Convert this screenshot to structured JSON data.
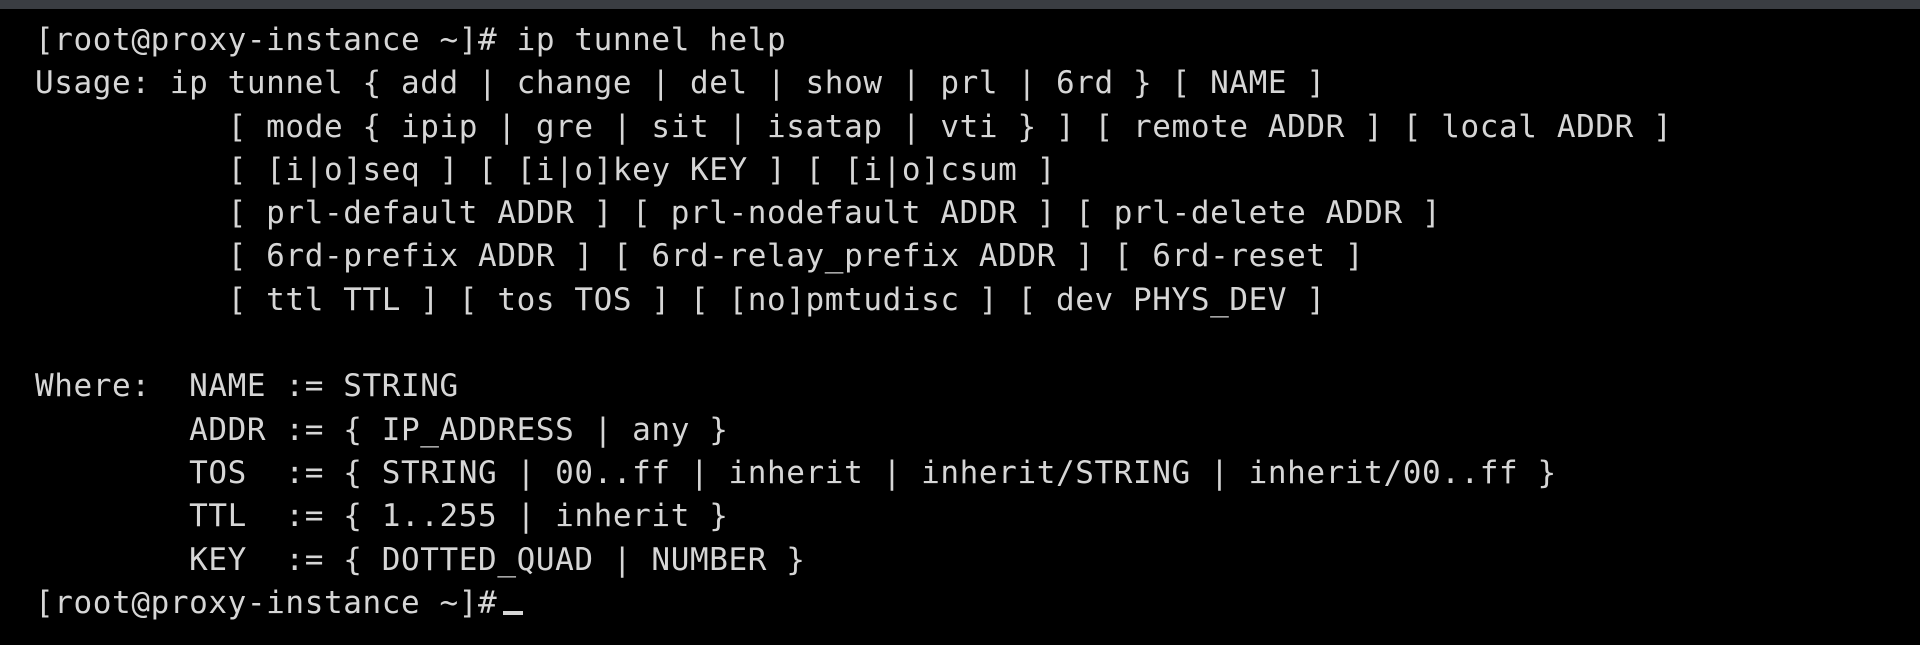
{
  "terminal": {
    "lines": [
      "[root@proxy-instance ~]# ip tunnel help",
      "Usage: ip tunnel { add | change | del | show | prl | 6rd } [ NAME ]",
      "          [ mode { ipip | gre | sit | isatap | vti } ] [ remote ADDR ] [ local ADDR ]",
      "          [ [i|o]seq ] [ [i|o]key KEY ] [ [i|o]csum ]",
      "          [ prl-default ADDR ] [ prl-nodefault ADDR ] [ prl-delete ADDR ]",
      "          [ 6rd-prefix ADDR ] [ 6rd-relay_prefix ADDR ] [ 6rd-reset ]",
      "          [ ttl TTL ] [ tos TOS ] [ [no]pmtudisc ] [ dev PHYS_DEV ]",
      "",
      "Where:  NAME := STRING",
      "        ADDR := { IP_ADDRESS | any }",
      "        TOS  := { STRING | 00..ff | inherit | inherit/STRING | inherit/00..ff }",
      "        TTL  := { 1..255 | inherit }",
      "        KEY  := { DOTTED_QUAD | NUMBER }"
    ],
    "prompt": "[root@proxy-instance ~]#"
  },
  "colors": {
    "background": "#000000",
    "text": "#d6d6d6",
    "topbar": "#3a3d42"
  }
}
